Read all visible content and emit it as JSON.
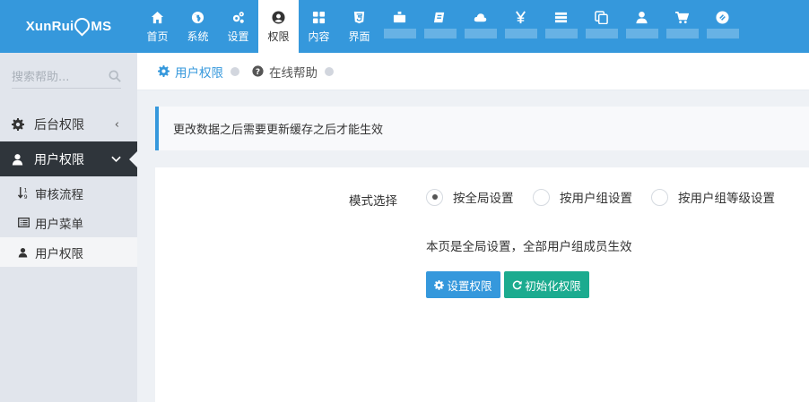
{
  "app": {
    "logo_left": "XunRui",
    "logo_right": "MS"
  },
  "nav": [
    {
      "label": "首页",
      "icon": "home-icon"
    },
    {
      "label": "系统",
      "icon": "globe-icon"
    },
    {
      "label": "设置",
      "icon": "cogs-icon"
    },
    {
      "label": "权限",
      "icon": "user-circle-icon",
      "active": true
    },
    {
      "label": "内容",
      "icon": "grid-icon"
    },
    {
      "label": "界面",
      "icon": "html5-icon"
    },
    {
      "label": "",
      "icon": "list-icon"
    },
    {
      "label": "",
      "icon": "tag-icon"
    },
    {
      "label": "",
      "icon": "cloud-icon"
    },
    {
      "label": "",
      "icon": "yen-icon"
    },
    {
      "label": "",
      "icon": "server-icon"
    },
    {
      "label": "",
      "icon": "copy-icon"
    },
    {
      "label": "",
      "icon": "user-icon"
    },
    {
      "label": "",
      "icon": "cart-icon"
    },
    {
      "label": "",
      "icon": "link-icon"
    }
  ],
  "sidebar": {
    "search_placeholder": "搜索帮助...",
    "group_collapsed": {
      "label": "后台权限"
    },
    "group_active": {
      "label": "用户权限"
    },
    "items": [
      {
        "label": "审核流程",
        "icon": "sort-numeric-icon"
      },
      {
        "label": "用户菜单",
        "icon": "list-alt-icon"
      },
      {
        "label": "用户权限",
        "icon": "user-icon"
      }
    ]
  },
  "breadcrumb": {
    "current": "用户权限",
    "help": "在线帮助"
  },
  "note": "更改数据之后需要更新缓存之后才能生效",
  "form": {
    "mode_label": "模式选择",
    "options": [
      {
        "label": "按全局设置",
        "selected": true
      },
      {
        "label": "按用户组设置",
        "selected": false
      },
      {
        "label": "按用户组等级设置",
        "selected": false
      }
    ],
    "info": "本页是全局设置，全部用户组成员生效",
    "btn_set": "设置权限",
    "btn_init": "初始化权限"
  },
  "colors": {
    "topbar": "#3598dc",
    "sidebar_active": "#2f353b",
    "btn_blue": "#3598dc",
    "btn_green": "#1bab8f"
  }
}
